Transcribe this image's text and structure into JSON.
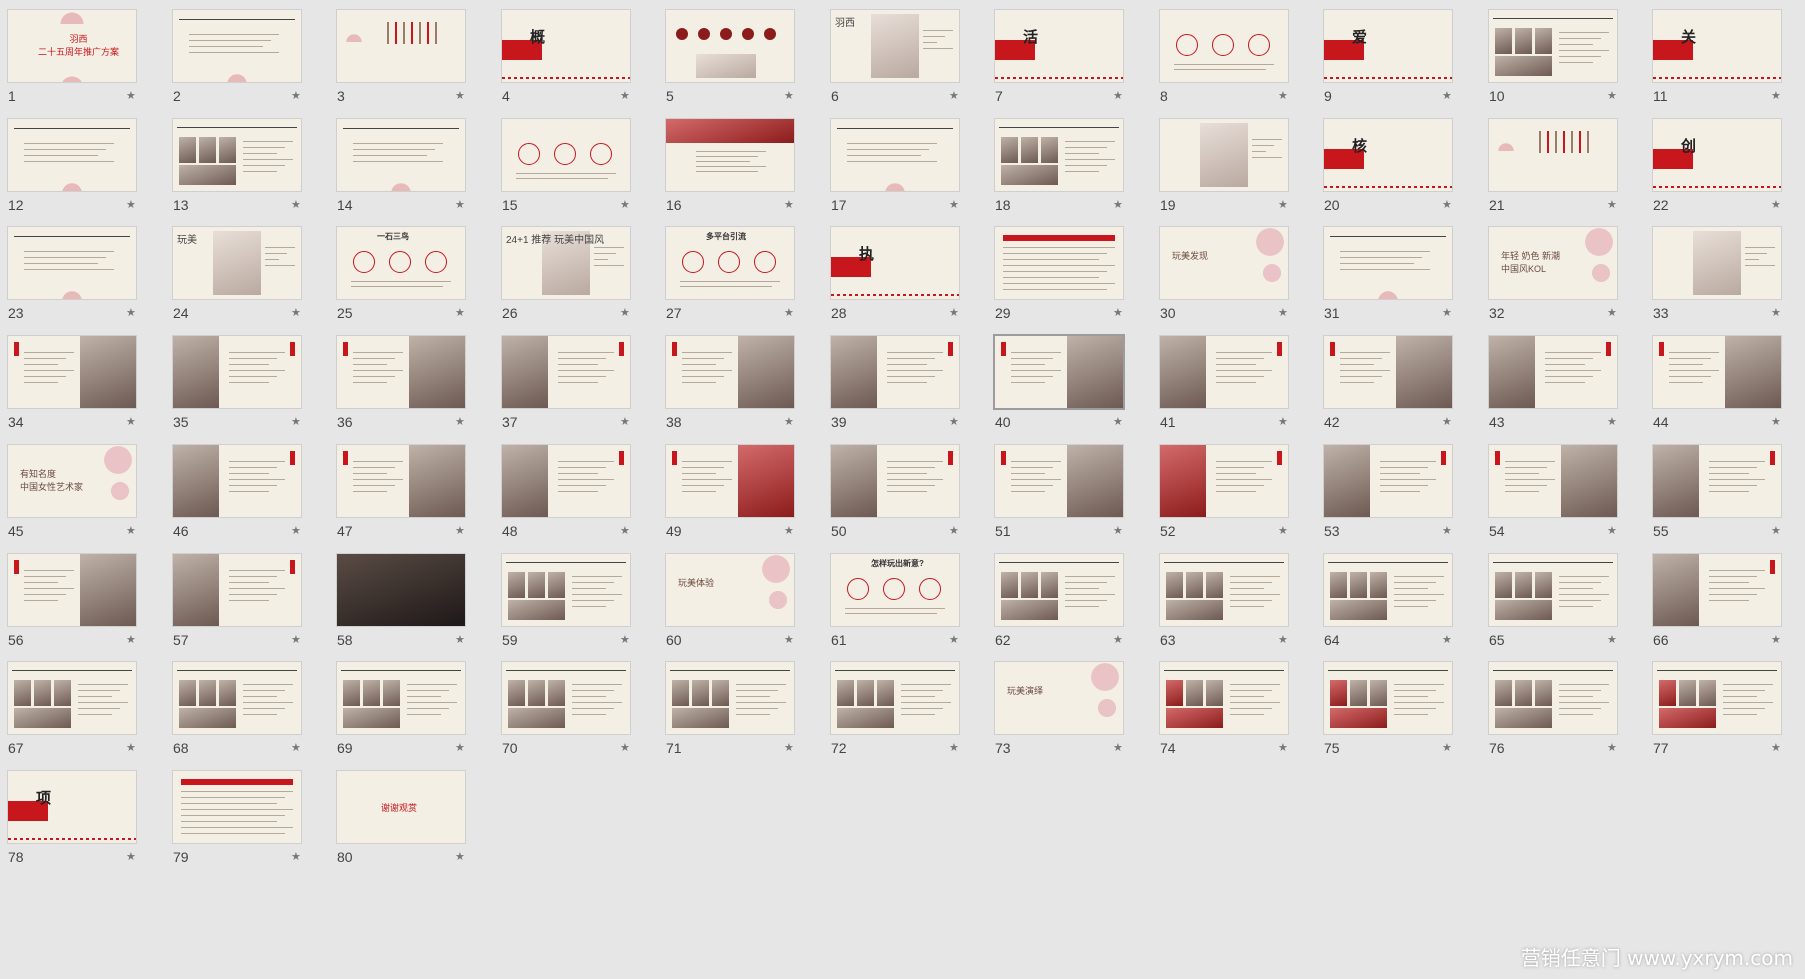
{
  "watermark": "营销任意门 www.yxrym.com",
  "selected_slide": "40",
  "slides": [
    {
      "number": "1",
      "text": "羽西\n二十五周年推广方案",
      "kind": "title"
    },
    {
      "number": "2",
      "text": "",
      "kind": "text"
    },
    {
      "number": "3",
      "text": "",
      "kind": "vert"
    },
    {
      "number": "4",
      "text": "概",
      "kind": "section"
    },
    {
      "number": "5",
      "text": "",
      "kind": "icons"
    },
    {
      "number": "6",
      "text": "羽西",
      "kind": "portrait"
    },
    {
      "number": "7",
      "text": "活",
      "kind": "section"
    },
    {
      "number": "8",
      "text": "",
      "kind": "circles"
    },
    {
      "number": "9",
      "text": "爱",
      "kind": "section"
    },
    {
      "number": "10",
      "text": "",
      "kind": "grid"
    },
    {
      "number": "11",
      "text": "关",
      "kind": "section"
    },
    {
      "number": "12",
      "text": "",
      "kind": "text"
    },
    {
      "number": "13",
      "text": "",
      "kind": "grid"
    },
    {
      "number": "14",
      "text": "",
      "kind": "text"
    },
    {
      "number": "15",
      "text": "",
      "kind": "circles"
    },
    {
      "number": "16",
      "text": "",
      "kind": "banner"
    },
    {
      "number": "17",
      "text": "",
      "kind": "text"
    },
    {
      "number": "18",
      "text": "",
      "kind": "grid"
    },
    {
      "number": "19",
      "text": "",
      "kind": "portrait"
    },
    {
      "number": "20",
      "text": "核",
      "kind": "section"
    },
    {
      "number": "21",
      "text": "",
      "kind": "vert"
    },
    {
      "number": "22",
      "text": "创",
      "kind": "section"
    },
    {
      "number": "23",
      "text": "",
      "kind": "text"
    },
    {
      "number": "24",
      "text": "玩美",
      "kind": "portrait"
    },
    {
      "number": "25",
      "text": "一石三鸟",
      "kind": "circles"
    },
    {
      "number": "26",
      "text": "24+1 推荐 玩美中国风",
      "kind": "portrait"
    },
    {
      "number": "27",
      "text": "多平台引流",
      "kind": "circles"
    },
    {
      "number": "28",
      "text": "执",
      "kind": "section"
    },
    {
      "number": "29",
      "text": "",
      "kind": "table"
    },
    {
      "number": "30",
      "text": "玩美发现",
      "kind": "blossom"
    },
    {
      "number": "31",
      "text": "",
      "kind": "text"
    },
    {
      "number": "32",
      "text": "年轻 奶色 新潮\n中国风KOL",
      "kind": "blossom"
    },
    {
      "number": "33",
      "text": "",
      "kind": "portrait"
    },
    {
      "number": "34",
      "text": "",
      "kind": "photoR"
    },
    {
      "number": "35",
      "text": "",
      "kind": "photoL"
    },
    {
      "number": "36",
      "text": "",
      "kind": "photoR"
    },
    {
      "number": "37",
      "text": "",
      "kind": "photoL"
    },
    {
      "number": "38",
      "text": "",
      "kind": "photoR"
    },
    {
      "number": "39",
      "text": "",
      "kind": "photoL"
    },
    {
      "number": "40",
      "text": "",
      "kind": "photoR"
    },
    {
      "number": "41",
      "text": "",
      "kind": "photoL"
    },
    {
      "number": "42",
      "text": "",
      "kind": "photoR"
    },
    {
      "number": "43",
      "text": "",
      "kind": "photoL"
    },
    {
      "number": "44",
      "text": "",
      "kind": "photoR"
    },
    {
      "number": "45",
      "text": "有知名度\n中国女性艺术家",
      "kind": "blossom"
    },
    {
      "number": "46",
      "text": "",
      "kind": "photoL"
    },
    {
      "number": "47",
      "text": "",
      "kind": "photoR"
    },
    {
      "number": "48",
      "text": "",
      "kind": "photoL"
    },
    {
      "number": "49",
      "text": "",
      "kind": "photoRred"
    },
    {
      "number": "50",
      "text": "",
      "kind": "photoL"
    },
    {
      "number": "51",
      "text": "",
      "kind": "photoR"
    },
    {
      "number": "52",
      "text": "",
      "kind": "photoLred"
    },
    {
      "number": "53",
      "text": "",
      "kind": "photoL"
    },
    {
      "number": "54",
      "text": "",
      "kind": "photoR"
    },
    {
      "number": "55",
      "text": "",
      "kind": "photoL"
    },
    {
      "number": "56",
      "text": "",
      "kind": "photoR"
    },
    {
      "number": "57",
      "text": "",
      "kind": "photoL"
    },
    {
      "number": "58",
      "text": "",
      "kind": "dark"
    },
    {
      "number": "59",
      "text": "",
      "kind": "grid"
    },
    {
      "number": "60",
      "text": "玩美体验",
      "kind": "blossom"
    },
    {
      "number": "61",
      "text": "怎样玩出新意?",
      "kind": "circles"
    },
    {
      "number": "62",
      "text": "",
      "kind": "grid"
    },
    {
      "number": "63",
      "text": "",
      "kind": "grid"
    },
    {
      "number": "64",
      "text": "",
      "kind": "grid"
    },
    {
      "number": "65",
      "text": "",
      "kind": "grid"
    },
    {
      "number": "66",
      "text": "",
      "kind": "photoL"
    },
    {
      "number": "67",
      "text": "",
      "kind": "grid"
    },
    {
      "number": "68",
      "text": "",
      "kind": "grid"
    },
    {
      "number": "69",
      "text": "",
      "kind": "grid"
    },
    {
      "number": "70",
      "text": "",
      "kind": "grid"
    },
    {
      "number": "71",
      "text": "",
      "kind": "grid"
    },
    {
      "number": "72",
      "text": "",
      "kind": "grid"
    },
    {
      "number": "73",
      "text": "玩美演绎",
      "kind": "blossom"
    },
    {
      "number": "74",
      "text": "",
      "kind": "gridred"
    },
    {
      "number": "75",
      "text": "",
      "kind": "gridred"
    },
    {
      "number": "76",
      "text": "",
      "kind": "grid"
    },
    {
      "number": "77",
      "text": "",
      "kind": "gridred"
    },
    {
      "number": "78",
      "text": "项",
      "kind": "section"
    },
    {
      "number": "79",
      "text": "",
      "kind": "table"
    },
    {
      "number": "80",
      "text": "谢谢观赏",
      "kind": "end"
    }
  ]
}
